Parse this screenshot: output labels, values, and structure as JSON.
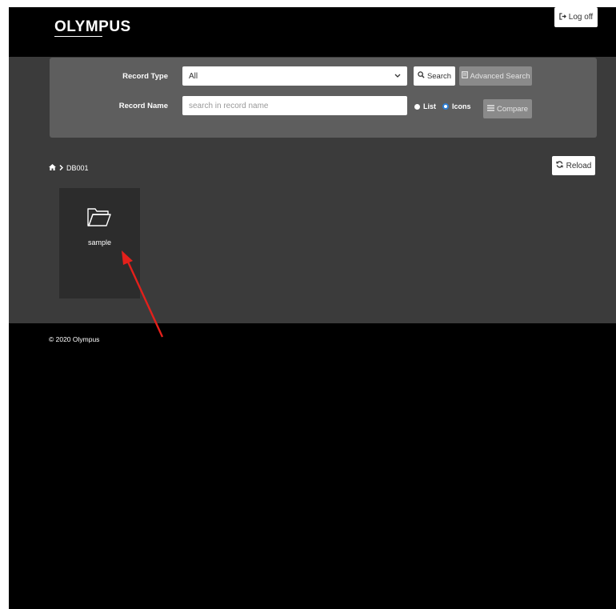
{
  "header": {
    "logo_text": "OLYMPUS",
    "logoff_label": "Log off"
  },
  "search": {
    "record_type_label": "Record Type",
    "record_type_value": "All",
    "record_name_label": "Record Name",
    "record_name_placeholder": "search in record name",
    "search_label": "Search",
    "advanced_search_label": "Advanced Search",
    "view_list_label": "List",
    "view_icons_label": "Icons",
    "view_selected": "Icons",
    "compare_label": "Compare"
  },
  "breadcrumb": {
    "current": "DB001"
  },
  "reload_label": "Reload",
  "items": [
    {
      "label": "sample",
      "icon": "folder-icon"
    }
  ],
  "footer": {
    "copyright": "© 2020 Olympus"
  },
  "colors": {
    "background": "#000000",
    "content": "#3b3b3b",
    "panel": "#5e5e5e",
    "tile": "#2c2c2c",
    "radio_selected": "#2d7dd2",
    "annotation_arrow": "#e3201b"
  }
}
